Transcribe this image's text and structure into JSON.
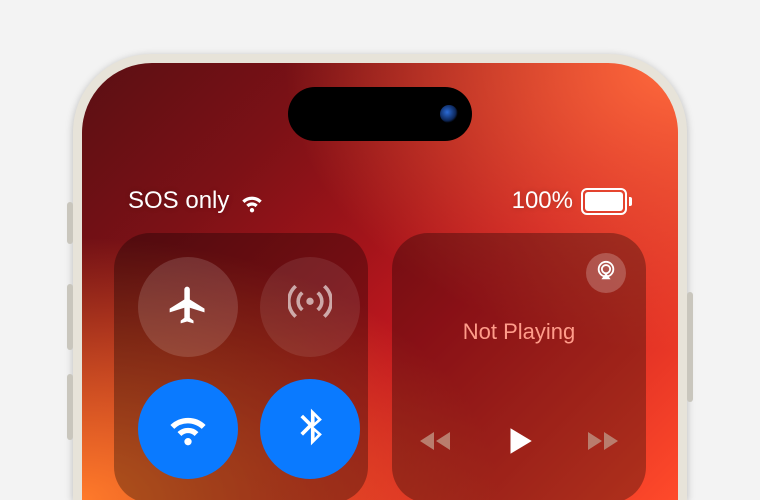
{
  "status_bar": {
    "carrier_text": "SOS only",
    "battery_percent_label": "100%",
    "battery_fill_pct": 100
  },
  "control_center": {
    "media": {
      "now_playing_label": "Not Playing"
    }
  }
}
